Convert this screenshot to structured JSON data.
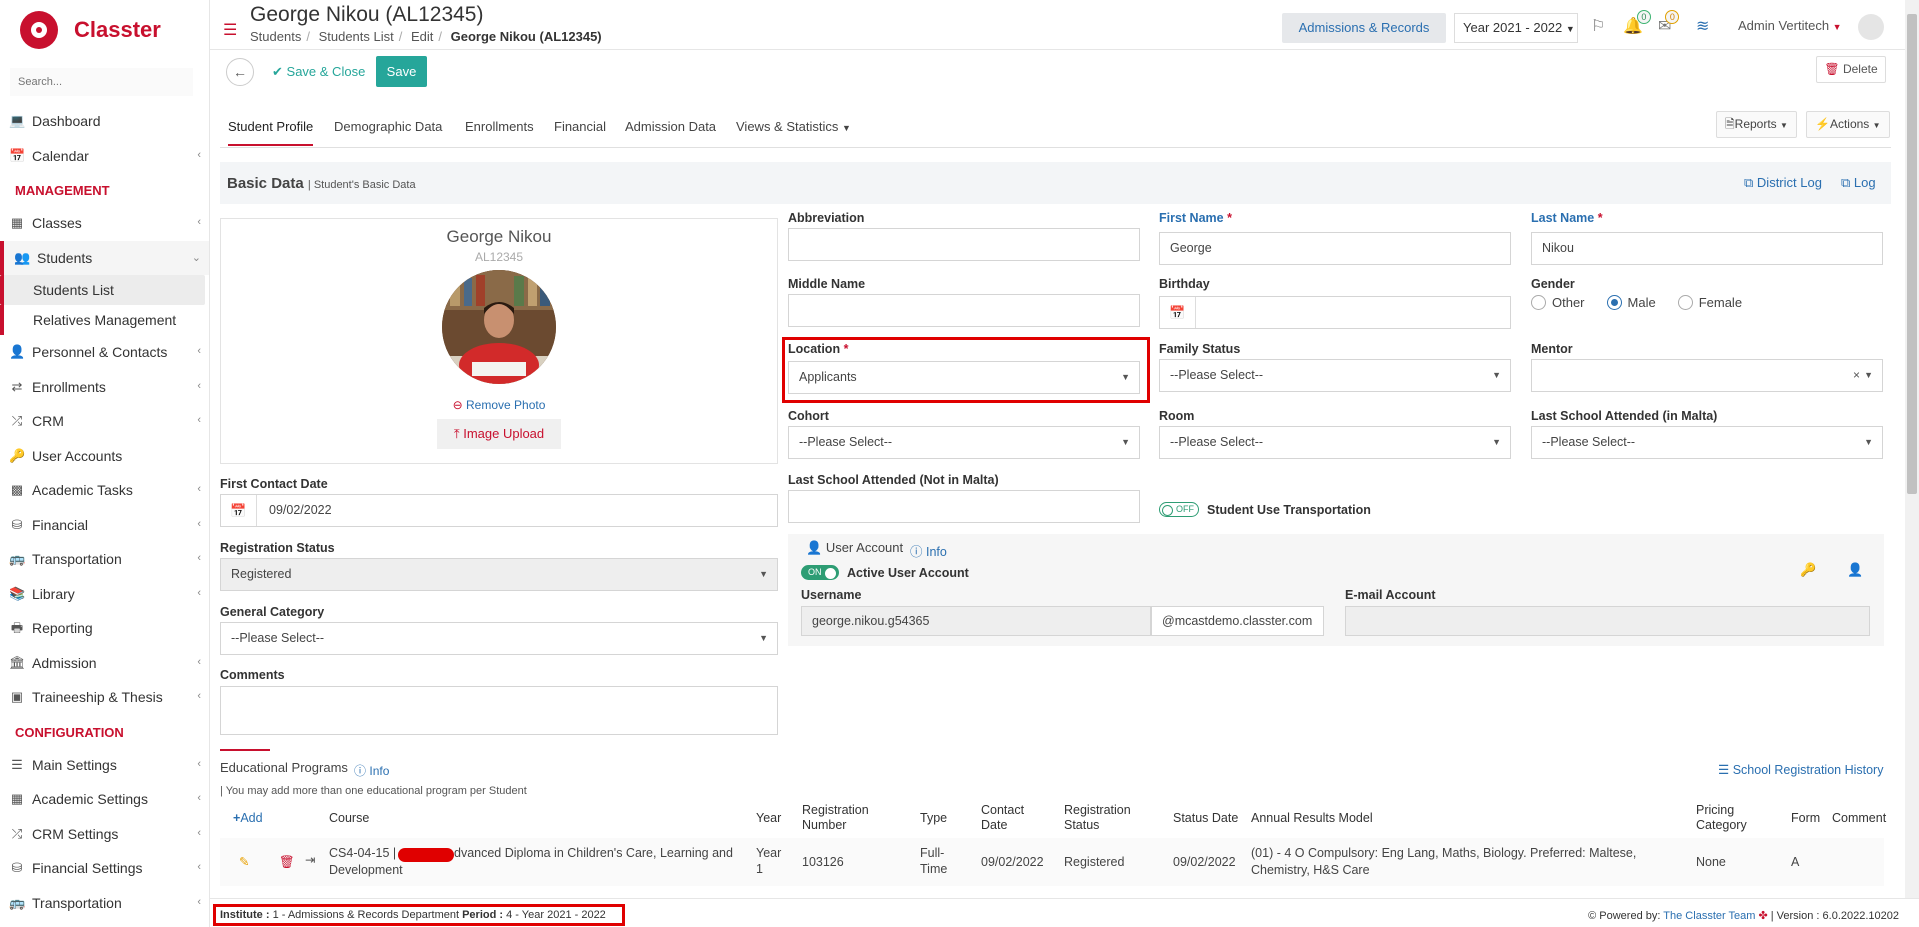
{
  "app": {
    "brand": "Classter",
    "accent": "#c8102e",
    "green": "#26a69a",
    "link": "#2a6fb0"
  },
  "sidebar": {
    "search_placeholder": "Search...",
    "items_top": [
      {
        "label": "Dashboard",
        "icon": "laptop-icon"
      },
      {
        "label": "Calendar",
        "icon": "calendar-icon"
      }
    ],
    "management_label": "MANAGEMENT",
    "management": [
      {
        "label": "Classes",
        "icon": "grid-icon"
      },
      {
        "label": "Students",
        "icon": "users-icon"
      }
    ],
    "students_sub": [
      "Students List",
      "Relatives Management"
    ],
    "management_rest": [
      {
        "label": "Personnel & Contacts",
        "icon": "person-icon"
      },
      {
        "label": "Enrollments",
        "icon": "exchange-icon"
      },
      {
        "label": "CRM",
        "icon": "crm-icon"
      },
      {
        "label": "User Accounts",
        "icon": "key-icon"
      },
      {
        "label": "Academic Tasks",
        "icon": "tasks-icon"
      },
      {
        "label": "Financial",
        "icon": "coins-icon"
      },
      {
        "label": "Transportation",
        "icon": "bus-icon"
      },
      {
        "label": "Library",
        "icon": "library-icon"
      },
      {
        "label": "Reporting",
        "icon": "print-icon"
      },
      {
        "label": "Admission",
        "icon": "bank-icon"
      },
      {
        "label": "Traineeship & Thesis",
        "icon": "box-icon"
      }
    ],
    "configuration_label": "CONFIGURATION",
    "configuration": [
      {
        "label": "Main Settings",
        "icon": "sliders-icon"
      },
      {
        "label": "Academic Settings",
        "icon": "grid-icon"
      },
      {
        "label": "CRM Settings",
        "icon": "crm-icon"
      },
      {
        "label": "Financial Settings",
        "icon": "coins-icon"
      },
      {
        "label": "Transportation",
        "icon": "bus-icon"
      }
    ]
  },
  "header": {
    "title": "George Nikou (AL12345)",
    "breadcrumb": [
      "Students",
      "Students List",
      "Edit",
      "George Nikou (AL12345)"
    ],
    "module": "Admissions & Records",
    "year": "Year 2021 - 2022",
    "notif_count": "0",
    "mail_count": "0",
    "user": "Admin Vertitech"
  },
  "actions": {
    "save_close": "Save & Close",
    "save": "Save",
    "delete": "Delete"
  },
  "tabs": [
    "Student Profile",
    "Demographic Data",
    "Enrollments",
    "Financial",
    "Admission Data",
    "Views & Statistics"
  ],
  "reports_label": "Reports",
  "actions_label": "Actions",
  "basic": {
    "title": "Basic Data",
    "subtitle": "Student's Basic Data",
    "district_log": "District Log",
    "log": "Log"
  },
  "photo": {
    "name": "George Nikou",
    "id": "AL12345",
    "remove": "Remove Photo",
    "upload": "Image Upload"
  },
  "fields": {
    "first_contact_label": "First Contact Date",
    "first_contact": "09/02/2022",
    "reg_status_label": "Registration Status",
    "reg_status": "Registered",
    "gen_cat_label": "General Category",
    "gen_cat": "--Please Select--",
    "comments_label": "Comments",
    "abbr_label": "Abbreviation",
    "first_name_label": "First Name",
    "first_name": "George",
    "last_name_label": "Last Name",
    "last_name": "Nikou",
    "middle_label": "Middle Name",
    "birthday_label": "Birthday",
    "gender_label": "Gender",
    "gender_options": [
      "Other",
      "Male",
      "Female"
    ],
    "gender_selected": "Male",
    "location_label": "Location",
    "location": "Applicants",
    "family_label": "Family Status",
    "family": "--Please Select--",
    "mentor_label": "Mentor",
    "cohort_label": "Cohort",
    "cohort": "--Please Select--",
    "room_label": "Room",
    "room": "--Please Select--",
    "last_school_malta_label": "Last School Attended (in Malta)",
    "last_school_malta": "--Please Select--",
    "last_school_not_label": "Last School Attended (Not in Malta)",
    "transport_toggle": "OFF",
    "transport_label": "Student Use Transportation"
  },
  "user_account": {
    "title": "User Account",
    "info": "Info",
    "toggle": "ON",
    "active_label": "Active User Account",
    "username_label": "Username",
    "username": "george.nikou.g54365",
    "domain": "@mcastdemo.classter.com",
    "email_label": "E-mail Account"
  },
  "programs": {
    "title": "Educational Programs",
    "info": "Info",
    "note": "| You may add more than one educational program per Student",
    "history": "School Registration History",
    "add": "Add",
    "headers": {
      "course": "Course",
      "year": "Year",
      "reg_no": "Registration Number",
      "type": "Type",
      "contact": "Contact Date",
      "reg_status": "Registration Status",
      "status_date": "Status Date",
      "arm": "Annual Results Model",
      "pricing": "Pricing Category",
      "form": "Form",
      "comment": "Comment"
    },
    "row": {
      "course_code": "CS4-04-15 |",
      "course_rest": "dvanced Diploma in Children's Care, Learning and",
      "course_line2": "Development",
      "year": "Year 1",
      "reg_no": "103126",
      "type": "Full-Time",
      "contact": "09/02/2022",
      "reg_status": "Registered",
      "status_date": "09/02/2022",
      "arm1": "(01) - 4 O Compulsory: Eng Lang, Maths, Biology. Preferred: Maltese,",
      "arm2": "Chemistry, H&S Care",
      "pricing": "None",
      "form": "A"
    }
  },
  "footer": {
    "institute_label": "Institute :",
    "institute": "1 - Admissions & Records Department",
    "period_label": "Period :",
    "period": "4 - Year 2021 - 2022",
    "powered": "Powered by:",
    "team": "The Classter Team",
    "version": "| Version : 6.0.2022.10202"
  }
}
